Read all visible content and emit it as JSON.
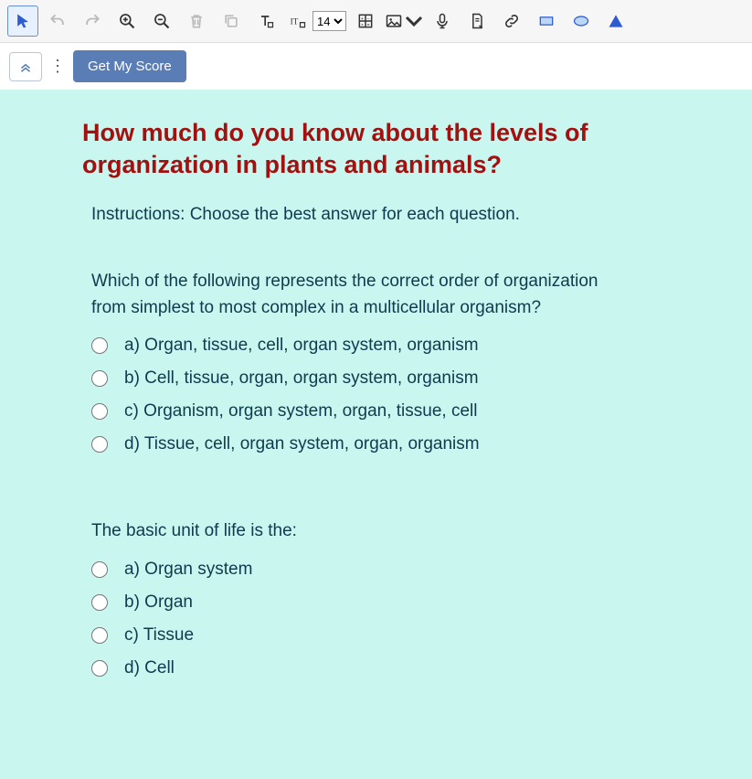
{
  "toolbar": {
    "font_size": "14"
  },
  "subbar": {
    "score_button": "Get My Score"
  },
  "worksheet": {
    "title": "How much do you know about the levels of organization in plants and animals?",
    "instructions": "Instructions: Choose the best answer for each question.",
    "questions": [
      {
        "text": " Which of the following represents the correct order of organization from simplest to most complex in a multicellular organism?",
        "options": [
          "a) Organ, tissue, cell, organ system, organism",
          "b) Cell, tissue, organ, organ system, organism",
          "c) Organism, organ system, organ, tissue, cell",
          "d) Tissue, cell, organ system, organ, organism"
        ]
      },
      {
        "text": " The basic unit of life is the:",
        "options": [
          "a) Organ system",
          "b) Organ",
          "c) Tissue",
          "d) Cell"
        ]
      }
    ]
  }
}
